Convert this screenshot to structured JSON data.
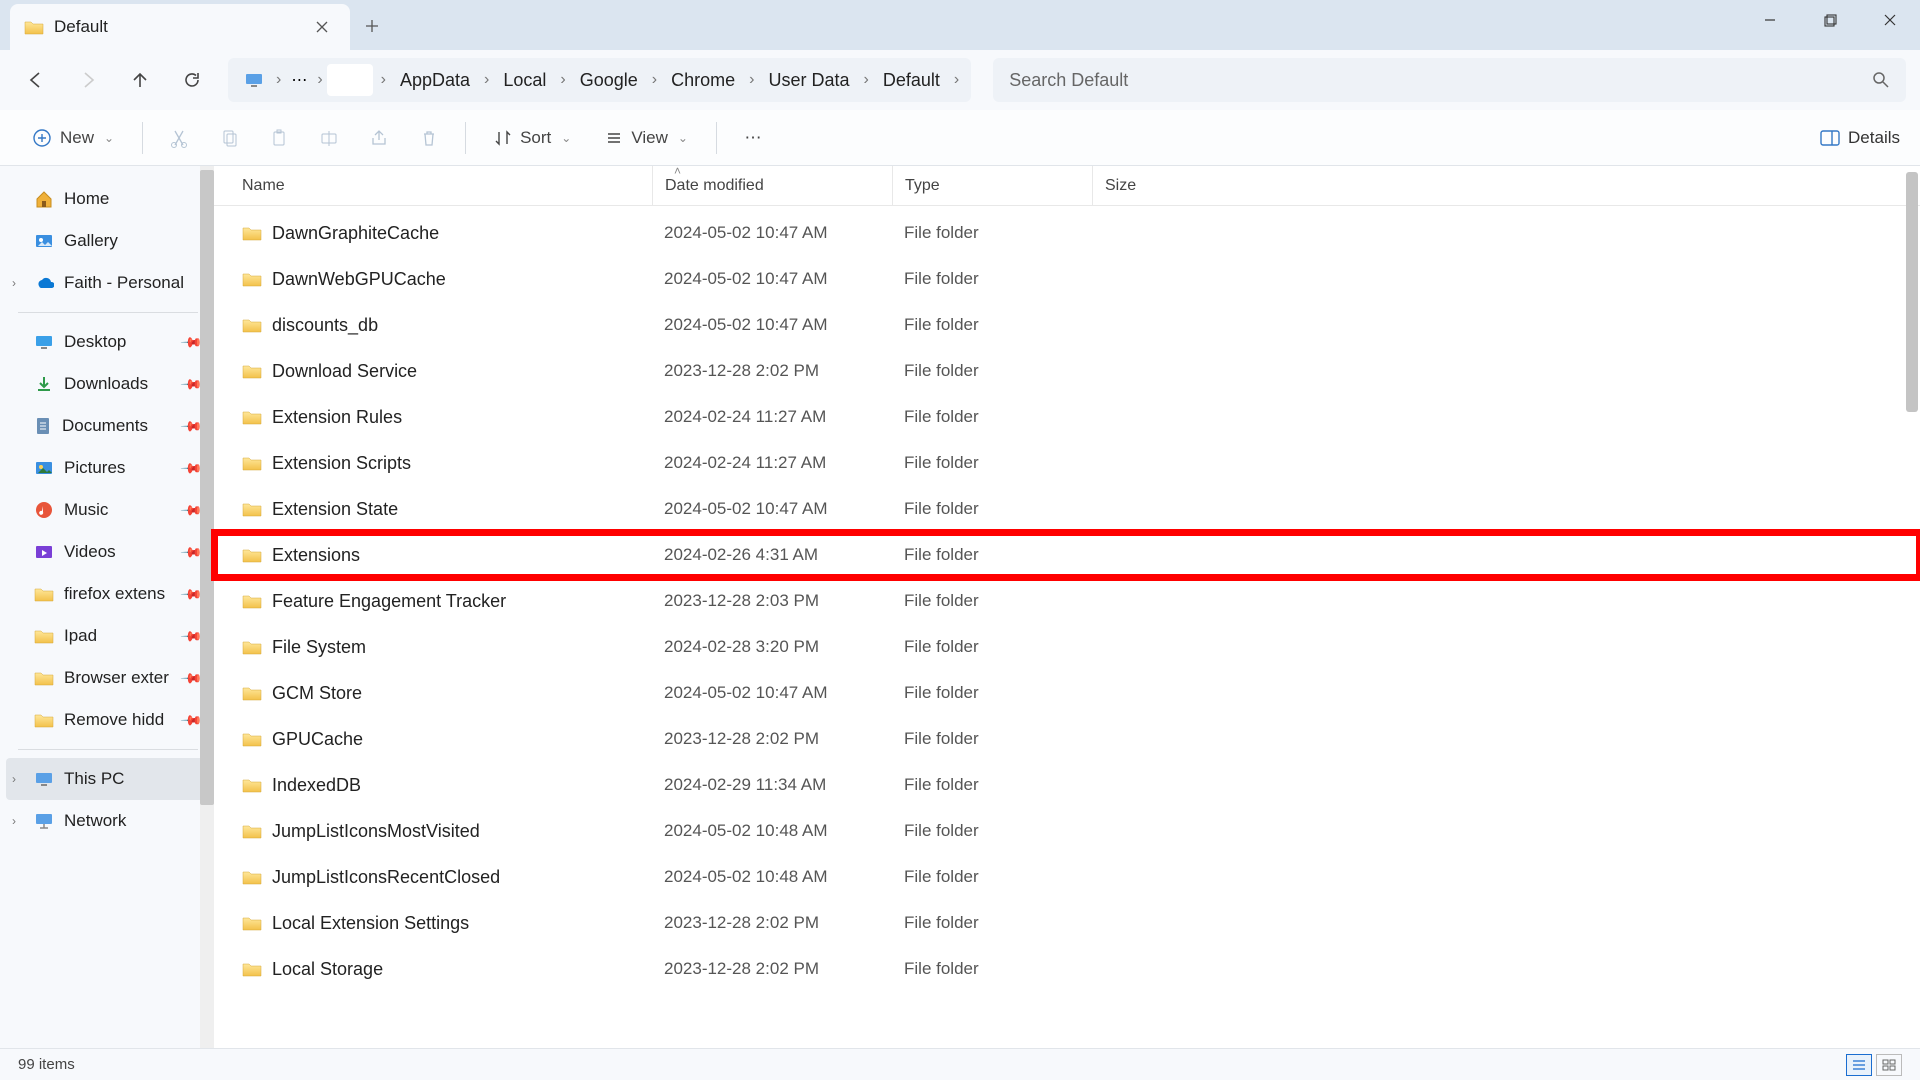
{
  "window": {
    "tab_title": "Default"
  },
  "breadcrumb": [
    "AppData",
    "Local",
    "Google",
    "Chrome",
    "User Data",
    "Default"
  ],
  "search": {
    "placeholder": "Search Default"
  },
  "toolbar": {
    "new_label": "New",
    "sort_label": "Sort",
    "view_label": "View",
    "details_label": "Details"
  },
  "sidebar": {
    "top": [
      {
        "label": "Home",
        "icon": "home"
      },
      {
        "label": "Gallery",
        "icon": "gallery"
      },
      {
        "label": "Faith - Personal",
        "icon": "onedrive",
        "expandable": true
      }
    ],
    "pinned": [
      {
        "label": "Desktop",
        "icon": "desktop"
      },
      {
        "label": "Downloads",
        "icon": "downloads"
      },
      {
        "label": "Documents",
        "icon": "documents"
      },
      {
        "label": "Pictures",
        "icon": "pictures"
      },
      {
        "label": "Music",
        "icon": "music"
      },
      {
        "label": "Videos",
        "icon": "videos"
      },
      {
        "label": "firefox extens",
        "icon": "folder"
      },
      {
        "label": "Ipad",
        "icon": "folder"
      },
      {
        "label": "Browser exter",
        "icon": "folder"
      },
      {
        "label": "Remove hidd",
        "icon": "folder"
      }
    ],
    "bottom": [
      {
        "label": "This PC",
        "icon": "pc",
        "selected": true,
        "expandable": true
      },
      {
        "label": "Network",
        "icon": "network",
        "expandable": true
      }
    ]
  },
  "columns": {
    "name": "Name",
    "date": "Date modified",
    "type": "Type",
    "size": "Size"
  },
  "rows": [
    {
      "name": "DawnGraphiteCache",
      "date": "2024-05-02 10:47 AM",
      "type": "File folder"
    },
    {
      "name": "DawnWebGPUCache",
      "date": "2024-05-02 10:47 AM",
      "type": "File folder"
    },
    {
      "name": "discounts_db",
      "date": "2024-05-02 10:47 AM",
      "type": "File folder"
    },
    {
      "name": "Download Service",
      "date": "2023-12-28 2:02 PM",
      "type": "File folder"
    },
    {
      "name": "Extension Rules",
      "date": "2024-02-24 11:27 AM",
      "type": "File folder"
    },
    {
      "name": "Extension Scripts",
      "date": "2024-02-24 11:27 AM",
      "type": "File folder"
    },
    {
      "name": "Extension State",
      "date": "2024-05-02 10:47 AM",
      "type": "File folder"
    },
    {
      "name": "Extensions",
      "date": "2024-02-26 4:31 AM",
      "type": "File folder",
      "highlight": true
    },
    {
      "name": "Feature Engagement Tracker",
      "date": "2023-12-28 2:03 PM",
      "type": "File folder"
    },
    {
      "name": "File System",
      "date": "2024-02-28 3:20 PM",
      "type": "File folder"
    },
    {
      "name": "GCM Store",
      "date": "2024-05-02 10:47 AM",
      "type": "File folder"
    },
    {
      "name": "GPUCache",
      "date": "2023-12-28 2:02 PM",
      "type": "File folder"
    },
    {
      "name": "IndexedDB",
      "date": "2024-02-29 11:34 AM",
      "type": "File folder"
    },
    {
      "name": "JumpListIconsMostVisited",
      "date": "2024-05-02 10:48 AM",
      "type": "File folder"
    },
    {
      "name": "JumpListIconsRecentClosed",
      "date": "2024-05-02 10:48 AM",
      "type": "File folder"
    },
    {
      "name": "Local Extension Settings",
      "date": "2023-12-28 2:02 PM",
      "type": "File folder"
    },
    {
      "name": "Local Storage",
      "date": "2023-12-28 2:02 PM",
      "type": "File folder"
    }
  ],
  "status": {
    "count_text": "99 items"
  }
}
